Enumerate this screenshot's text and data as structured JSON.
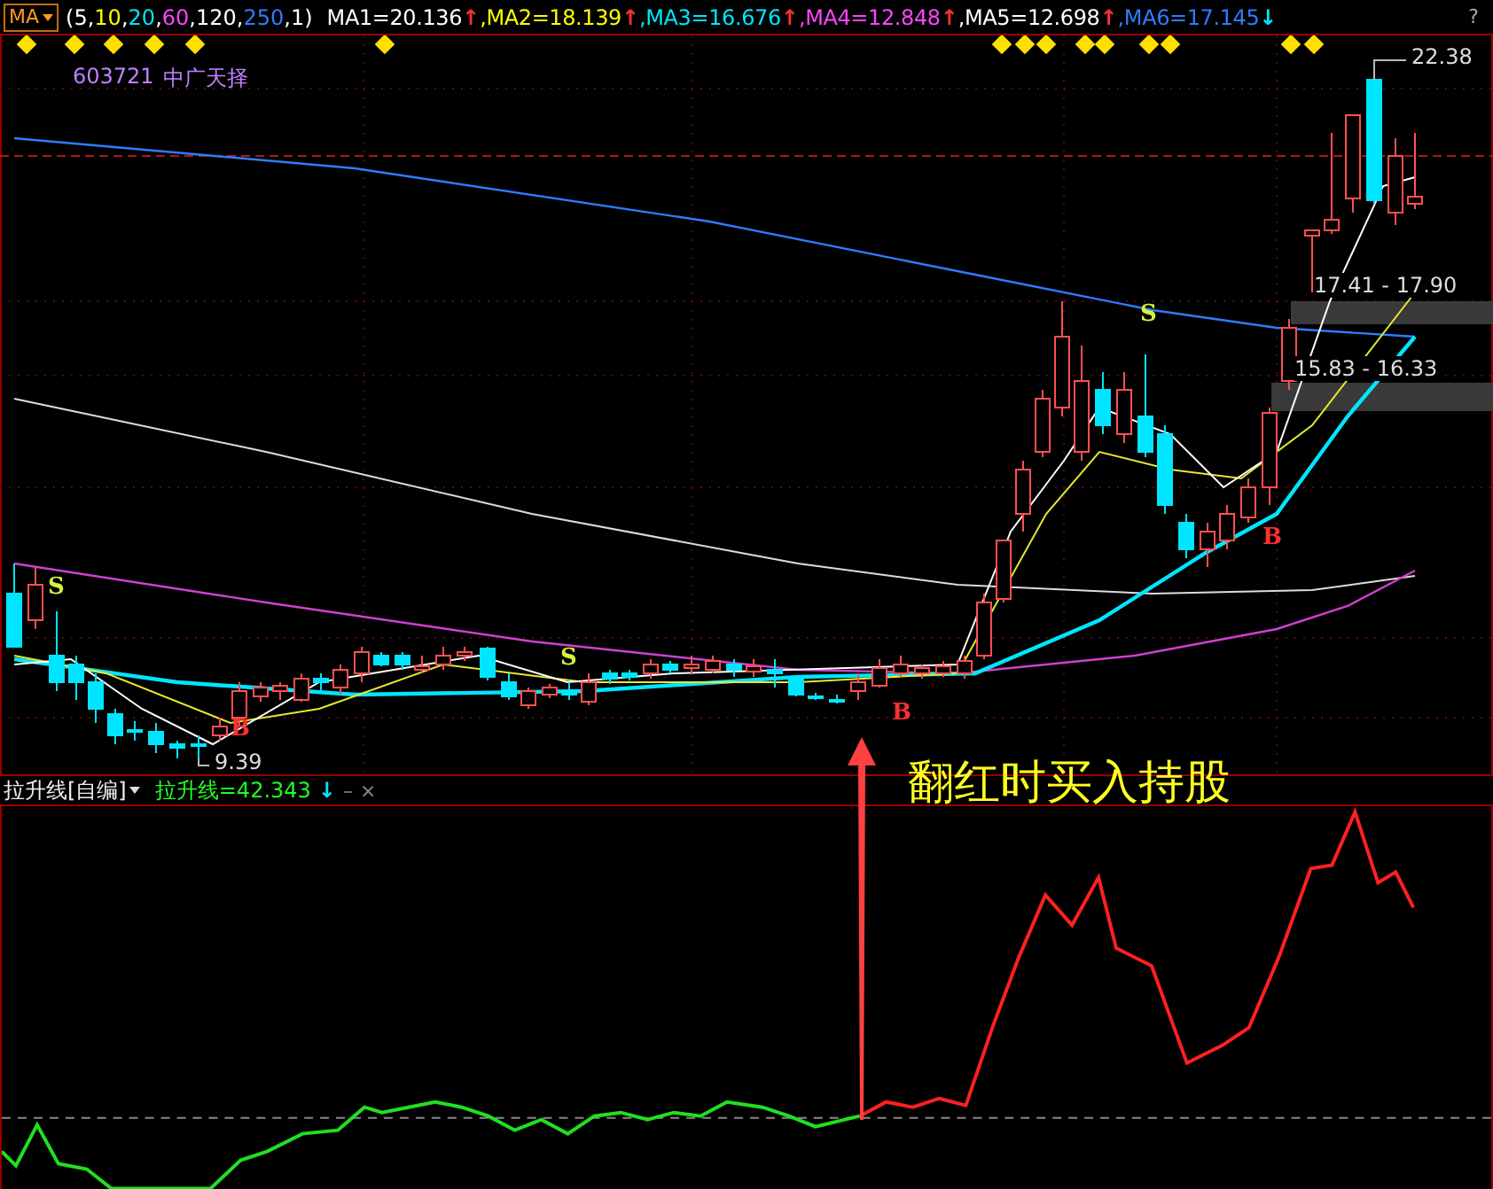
{
  "header": {
    "indicator_button": "MA",
    "params_open": "(",
    "params_separator": ",",
    "params_close": ")",
    "params": [
      {
        "text": "5",
        "color": "#ffffff"
      },
      {
        "text": "10",
        "color": "#ffff00"
      },
      {
        "text": "20",
        "color": "#00e5ff"
      },
      {
        "text": "60",
        "color": "#ff44ff"
      },
      {
        "text": "120",
        "color": "#ffffff"
      },
      {
        "text": "250",
        "color": "#2f7cff"
      },
      {
        "text": "1",
        "color": "#ffffff"
      }
    ],
    "ma_values": [
      {
        "label": "MA1=20.136",
        "color": "#ffffff",
        "arrow": {
          "text": "↑",
          "color": "#ff3030"
        }
      },
      {
        "label": ",MA2=18.139",
        "color": "#ffff00",
        "arrow": {
          "text": "↑",
          "color": "#ff3030"
        }
      },
      {
        "label": ",MA3=16.676",
        "color": "#00e5ff",
        "arrow": {
          "text": "↑",
          "color": "#ff3030"
        }
      },
      {
        "label": ",MA4=12.848",
        "color": "#ff44ff",
        "arrow": {
          "text": "↑",
          "color": "#ff3030"
        }
      },
      {
        "label": ",MA5=12.698",
        "color": "#ffffff",
        "arrow": {
          "text": "↑",
          "color": "#ff3030"
        }
      },
      {
        "label": ",MA6=17.145",
        "color": "#2f7cff",
        "arrow": {
          "text": "↓",
          "color": "#00e5ff"
        }
      }
    ],
    "help": "?"
  },
  "stock": {
    "code": "603721",
    "name": "中广天择"
  },
  "price_labels": {
    "high": "22.38",
    "low": "9.39",
    "range_upper": "17.41 - 17.90",
    "range_lower": "15.83 - 16.33"
  },
  "signals": [
    {
      "kind": "sell",
      "label": "S"
    },
    {
      "kind": "buy",
      "label": "B"
    },
    {
      "kind": "sell",
      "label": "S"
    },
    {
      "kind": "buy",
      "label": "B"
    },
    {
      "kind": "sell",
      "label": "S"
    },
    {
      "kind": "buy",
      "label": "B"
    }
  ],
  "annotation": "翻红时买入持股",
  "indicator": {
    "name": "拉升线[自编]",
    "value": "拉升线=42.343",
    "arrow": {
      "text": "↓",
      "color": "#00e5ff"
    },
    "minimize": "–",
    "close": "×"
  }
}
